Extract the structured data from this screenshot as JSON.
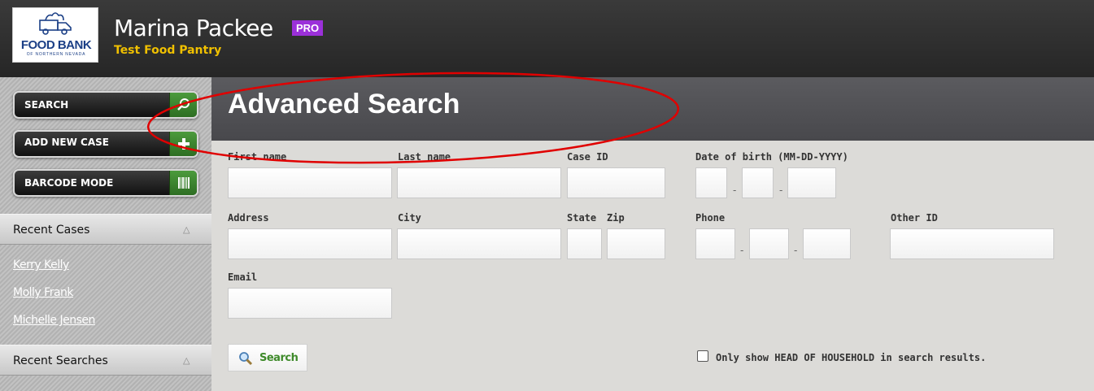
{
  "header": {
    "logo": {
      "main": "FOOD BANK",
      "sub": "OF NORTHERN NEVADA"
    },
    "user_name": "Marina Packee",
    "badge": "PRO",
    "pantry": "Test Food Pantry"
  },
  "sidebar": {
    "buttons": [
      {
        "label": "SEARCH",
        "icon": "search-icon"
      },
      {
        "label": "ADD NEW CASE",
        "icon": "plus-icon"
      },
      {
        "label": "BARCODE MODE",
        "icon": "barcode-icon"
      }
    ],
    "recent_cases": {
      "title": "Recent Cases",
      "items": [
        "Kerry Kelly",
        "Molly Frank",
        "Michelle Jensen"
      ]
    },
    "recent_searches": {
      "title": "Recent Searches"
    }
  },
  "main": {
    "title": "Advanced Search",
    "labels": {
      "first_name": "First name",
      "last_name": "Last name",
      "case_id": "Case ID",
      "dob": "Date of birth (MM-DD-YYYY)",
      "address": "Address",
      "city": "City",
      "state": "State",
      "zip": "Zip",
      "phone": "Phone",
      "other_id": "Other ID",
      "email": "Email"
    },
    "dash": "-",
    "search_button": "Search",
    "hoh_checkbox": {
      "label": "Only show HEAD OF HOUSEHOLD in search results.",
      "checked": false
    }
  },
  "colors": {
    "accent_green": "#3e8a2a",
    "pro_badge": "#9b30d9",
    "pantry_text": "#f0c000",
    "annotation": "#e00000"
  }
}
